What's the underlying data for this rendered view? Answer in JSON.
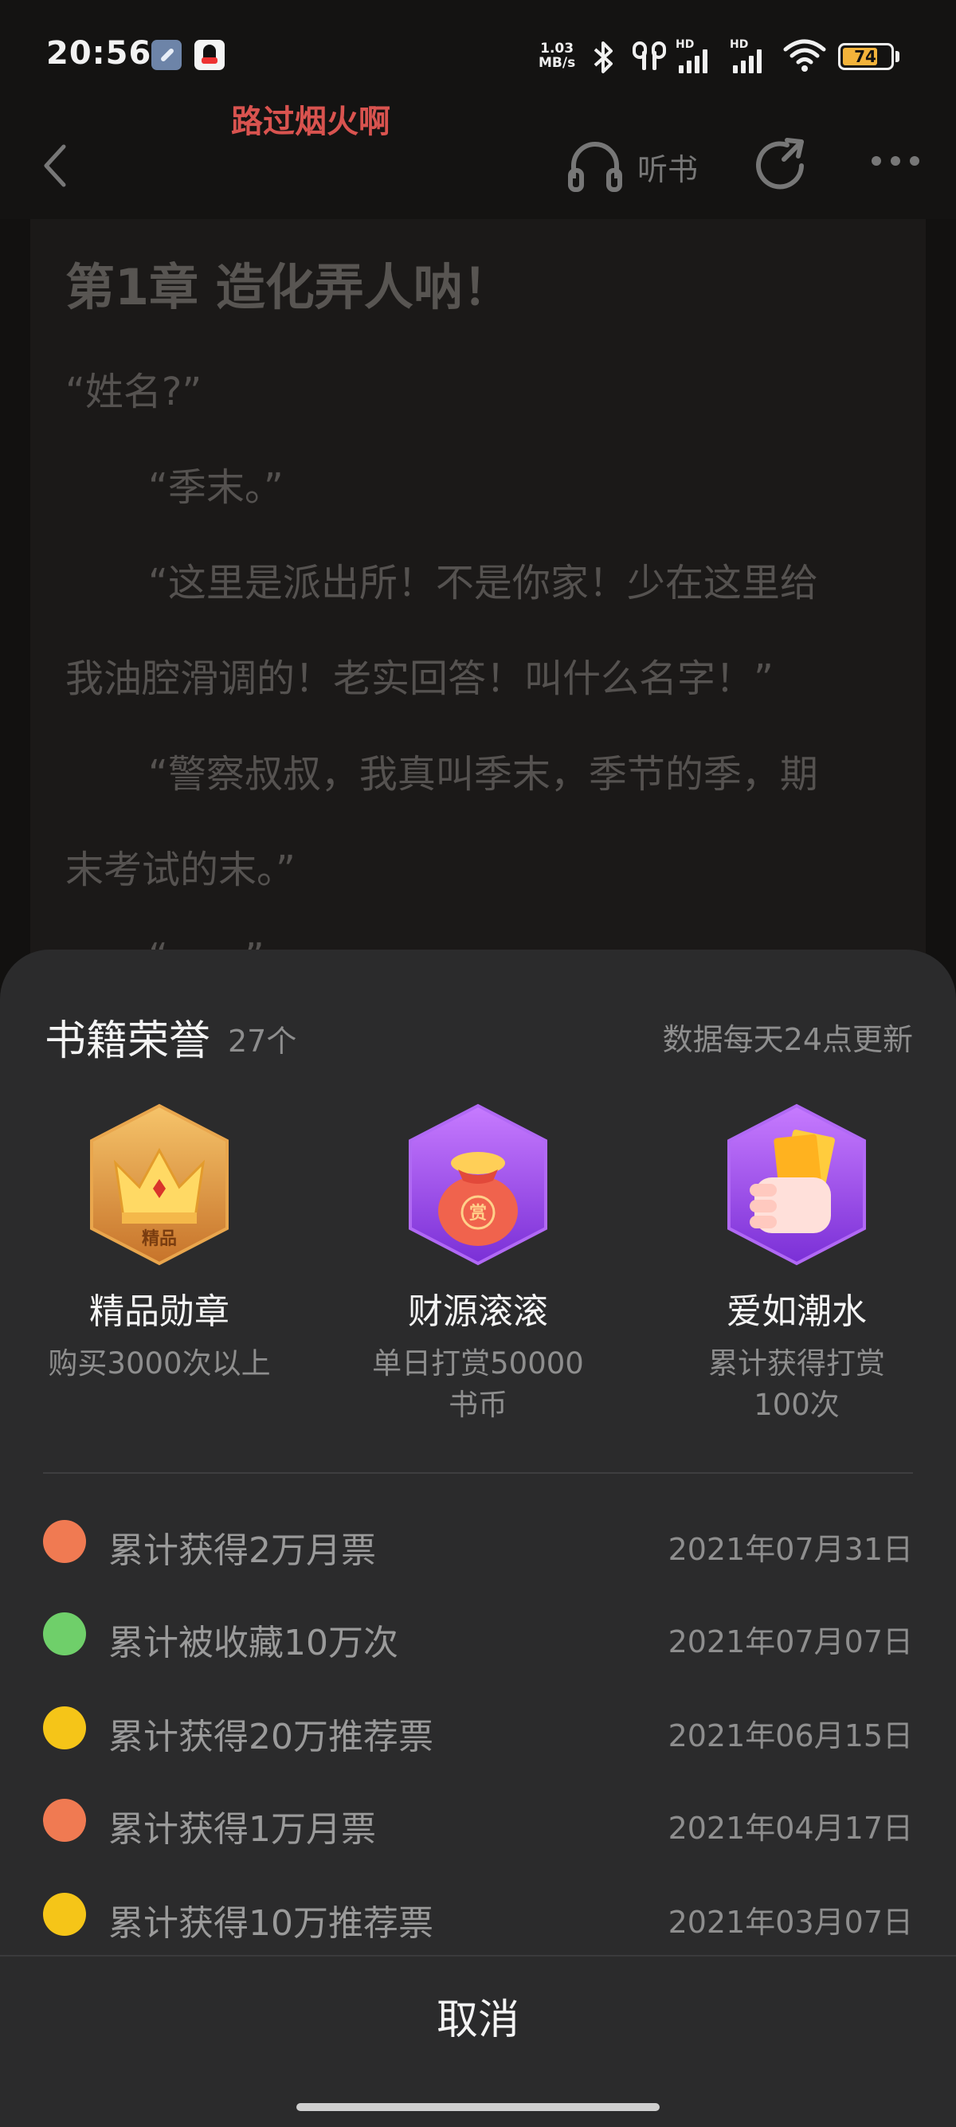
{
  "status_bar": {
    "time": "20:56",
    "net_speed_value": "1.03",
    "net_speed_unit": "MB/s",
    "signal_1": "HD",
    "signal_2": "HD",
    "battery": "74"
  },
  "header": {
    "author": "路过烟火啊",
    "listen_label": "听书"
  },
  "reader": {
    "chapter_title": "第1章 造化弄人呐！",
    "paragraphs": [
      "“姓名?”",
      "“季末。”",
      "“这里是派出所！不是你家！少在这里给",
      "我油腔滑调的！老实回答！叫什么名字！”",
      "“警察叔叔，我真叫季末，季节的季，期",
      "末考试的末。”",
      "“……”"
    ]
  },
  "sheet": {
    "title": "书籍荣誉",
    "count": "27个",
    "note": "数据每天24点更新",
    "badges": [
      {
        "name": "精品勋章",
        "desc": "购买3000次以上",
        "icon_text": "精品"
      },
      {
        "name": "财源滚滚",
        "desc": "单日打赏50000书币",
        "icon_text": "赏"
      },
      {
        "name": "爱如潮水",
        "desc": "累计获得打赏100次"
      }
    ],
    "honors": [
      {
        "label": "累计获得2万月票",
        "date": "2021年07月31日",
        "icon": "ticket-icon"
      },
      {
        "label": "累计被收藏10万次",
        "date": "2021年07月07日",
        "icon": "star-icon"
      },
      {
        "label": "累计获得20万推荐票",
        "date": "2021年06月15日",
        "icon": "recommend-ticket-icon"
      },
      {
        "label": "累计获得1万月票",
        "date": "2021年04月17日",
        "icon": "ticket-icon"
      },
      {
        "label": "累计获得10万推荐票",
        "date": "2021年03月07日",
        "icon": "recommend-ticket-icon"
      }
    ],
    "cancel_label": "取消"
  },
  "colors": {
    "author_red": "#d9534f",
    "sheet_bg": "#2b2b2c",
    "ticket_orange": "#f07a52",
    "star_green": "#6fcf6a",
    "recommend_yellow": "#f5c518"
  }
}
